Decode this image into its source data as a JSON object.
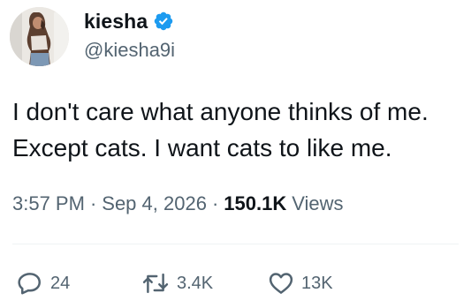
{
  "author": {
    "display_name": "kiesha",
    "handle": "@kiesha9i",
    "verified": true,
    "verified_color": "#1d9bf0"
  },
  "tweet": {
    "text": "I don't care what anyone thinks of me.\nExcept cats. I want cats to like me.",
    "time": "3:57 PM",
    "date": "Sep 4, 2026",
    "separator": "·",
    "views_count": "150.1K",
    "views_label": "Views"
  },
  "actions": {
    "reply_count": "24",
    "repost_count": "3.4K",
    "like_count": "13K"
  },
  "colors": {
    "text_primary": "#0f1419",
    "text_secondary": "#536471",
    "divider": "#eff3f4"
  },
  "icons": {
    "reply": "reply-icon",
    "repost": "repost-icon",
    "like": "heart-icon",
    "verified": "verified-badge-icon"
  }
}
